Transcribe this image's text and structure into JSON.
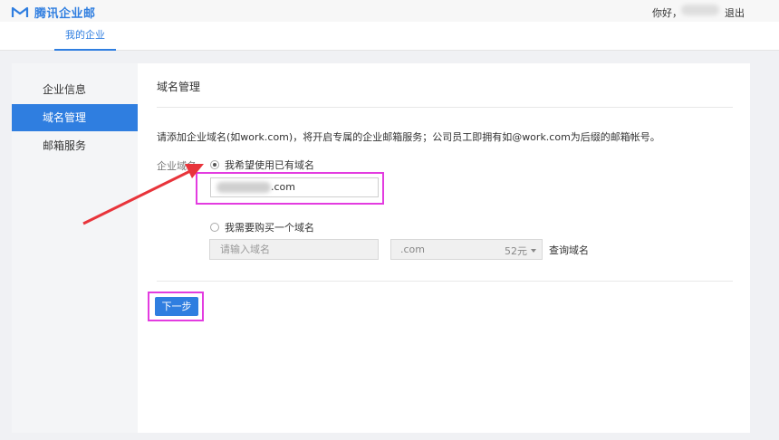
{
  "brand": {
    "name": "腾讯企业邮",
    "accent": "#2f7ee0"
  },
  "header": {
    "greeting": "你好，",
    "logout": "退出"
  },
  "nav": {
    "tab": "我的企业"
  },
  "sidebar": {
    "items": [
      {
        "label": "企业信息"
      },
      {
        "label": "域名管理"
      },
      {
        "label": "邮箱服务"
      }
    ]
  },
  "main": {
    "title": "域名管理",
    "description": "请添加企业域名(如work.com)，将开启专属的企业邮箱服务；公司员工即拥有如@work.com为后缀的邮箱帐号。",
    "field_label": "企业域名:",
    "option_existing": {
      "label": "我希望使用已有域名",
      "selected": true
    },
    "existing_domain_suffix": ".com",
    "option_buy": {
      "label": "我需要购买一个域名",
      "selected": false
    },
    "buy_placeholder": "请输入域名",
    "suffix_select": {
      "value": ".com",
      "price": "52元"
    },
    "query_link": "查询域名",
    "next_button": "下一步"
  },
  "annotations": {
    "highlight_color": "#e33ce0",
    "arrow_color": "#e8343b"
  }
}
